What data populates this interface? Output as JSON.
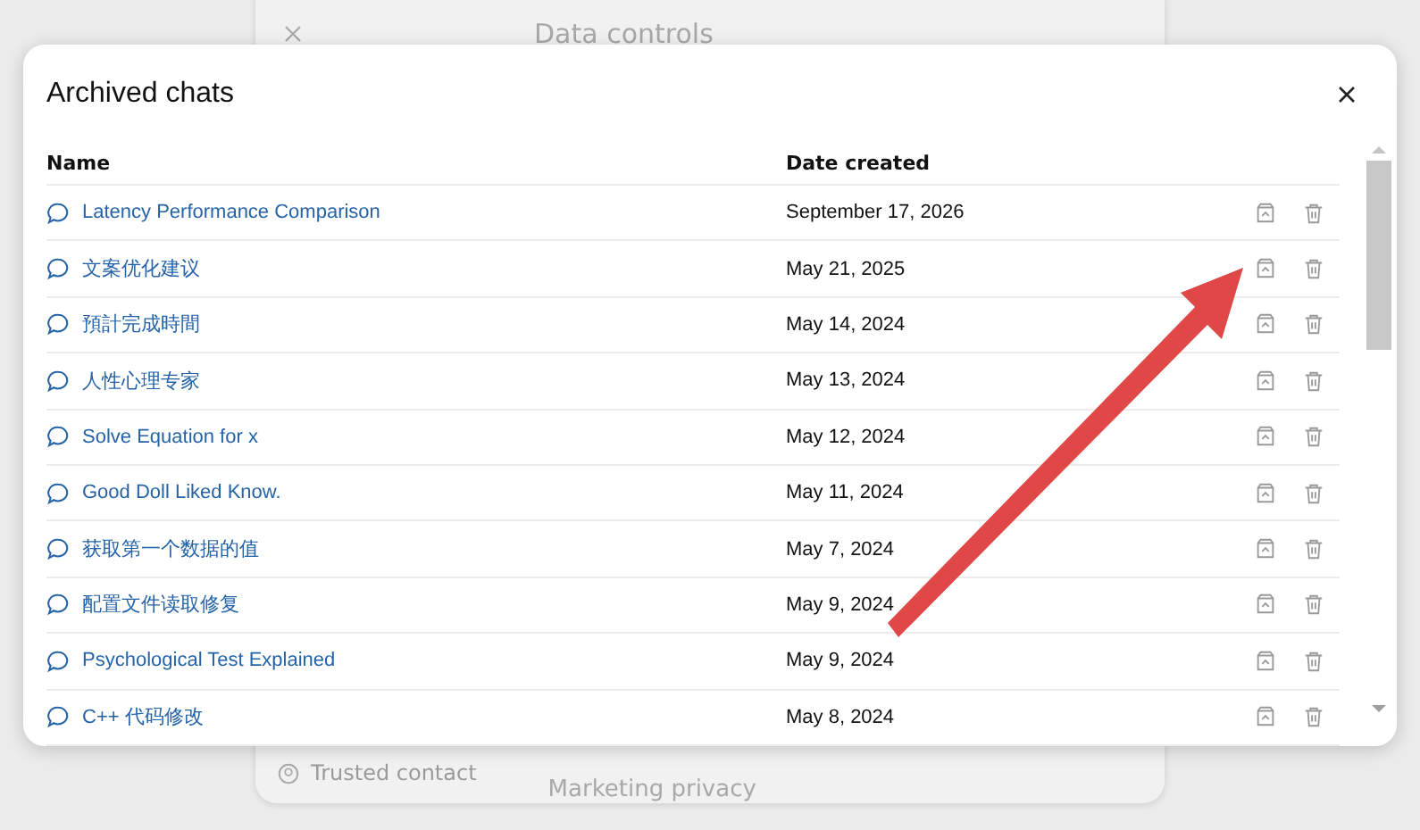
{
  "background_dialog": {
    "title": "Data controls",
    "items": [
      {
        "label": "Trusted contact"
      }
    ],
    "side_label": "Marketing privacy"
  },
  "dialog": {
    "title": "Archived chats",
    "columns": [
      "Name",
      "Date created"
    ],
    "rows": [
      {
        "name": "Latency Performance Comparison",
        "date": "September 17, 2026"
      },
      {
        "name": "文案优化建议",
        "date": "May 21, 2025"
      },
      {
        "name": "預計完成時間",
        "date": "May 14, 2024"
      },
      {
        "name": "人性心理专家",
        "date": "May 13, 2024"
      },
      {
        "name": "Solve Equation for x",
        "date": "May 12, 2024"
      },
      {
        "name": "Good Doll Liked Know.",
        "date": "May 11, 2024"
      },
      {
        "name": "获取第一个数据的值",
        "date": "May 7, 2024"
      },
      {
        "name": "配置文件读取修复",
        "date": "May 9, 2024"
      },
      {
        "name": "Psychological Test Explained",
        "date": "May 9, 2024"
      },
      {
        "name": "C++ 代码修改",
        "date": "May 8, 2024"
      }
    ]
  }
}
